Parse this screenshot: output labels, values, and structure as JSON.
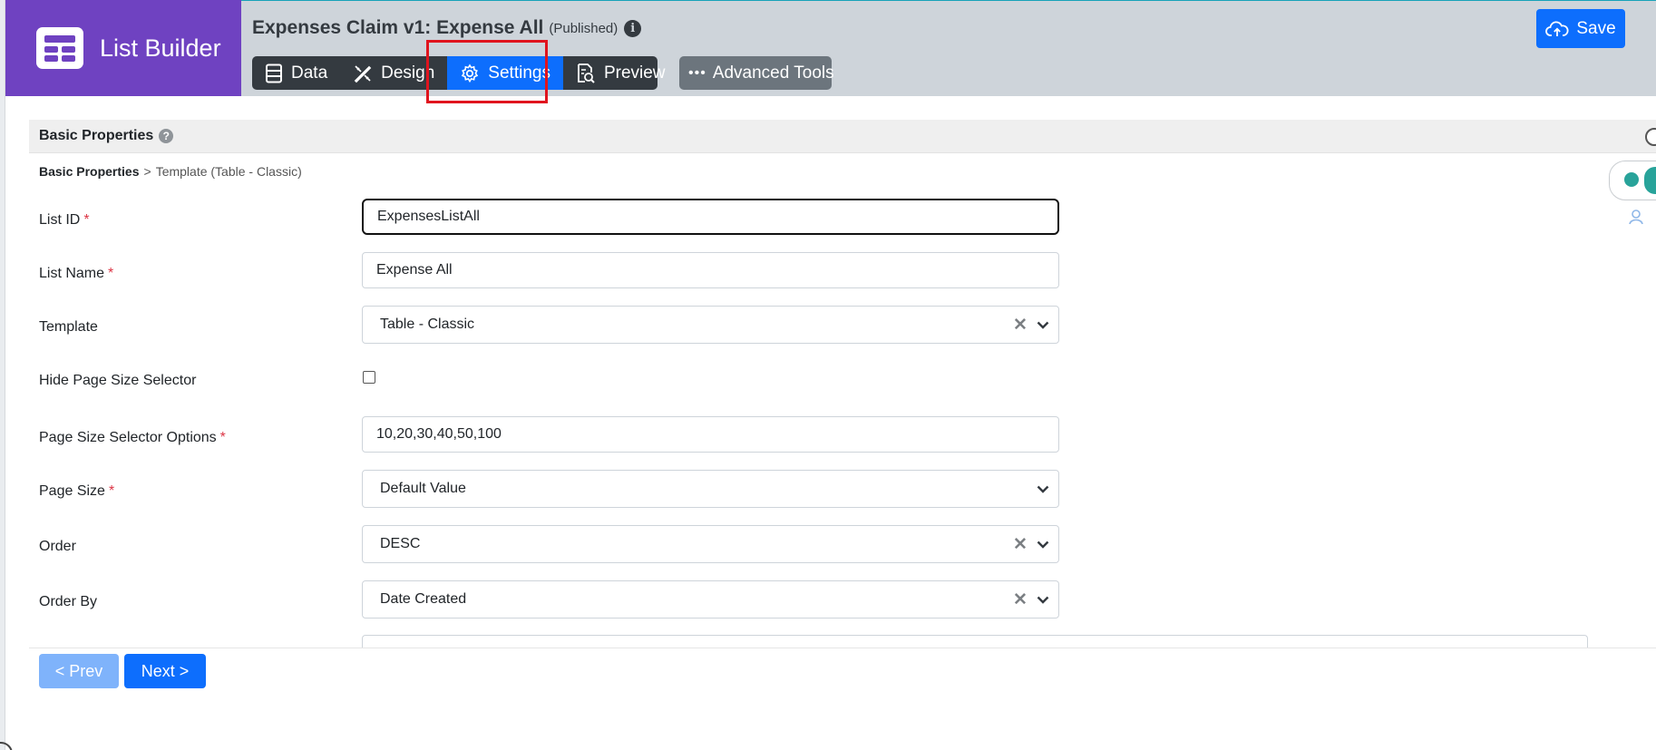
{
  "brand": {
    "title": "List Builder"
  },
  "header": {
    "title": "Expenses Claim v1: Expense All",
    "status": "(Published)",
    "info_icon": "i",
    "tabs": [
      {
        "label": "Data",
        "icon": "table-icon"
      },
      {
        "label": "Design",
        "icon": "design-tools-icon"
      },
      {
        "label": "Settings",
        "icon": "gear-icon",
        "active": true
      },
      {
        "label": "Preview",
        "icon": "document-search-icon"
      }
    ],
    "advanced_tools": "Advanced Tools",
    "advanced_dots": "•••",
    "save_label": "Save"
  },
  "section": {
    "title": "Basic Properties",
    "help_icon": "?",
    "breadcrumb": {
      "current": "Basic Properties",
      "separator": ">",
      "next": "Template (Table - Classic)"
    }
  },
  "form": {
    "required_mark": "*",
    "fields": {
      "list_id": {
        "label": "List ID",
        "value": "ExpensesListAll"
      },
      "list_name": {
        "label": "List Name",
        "value": "Expense All"
      },
      "template": {
        "label": "Template",
        "value": "Table - Classic"
      },
      "hide_page_size": {
        "label": "Hide Page Size Selector",
        "checked": false
      },
      "page_size_options": {
        "label": "Page Size Selector Options",
        "value": "10,20,30,40,50,100"
      },
      "page_size": {
        "label": "Page Size",
        "value": "Default Value"
      },
      "order": {
        "label": "Order",
        "value": "DESC"
      },
      "order_by": {
        "label": "Order By",
        "value": "Date Created"
      }
    },
    "clear_glyph": "✕"
  },
  "nav": {
    "prev_label": "< Prev",
    "next_label": "Next >"
  },
  "colors": {
    "brand_purple": "#6f42c1",
    "primary_blue": "#0d6efd",
    "tab_dark": "#343a40",
    "highlight_red": "#e0141e",
    "required_red": "#dc3545"
  }
}
